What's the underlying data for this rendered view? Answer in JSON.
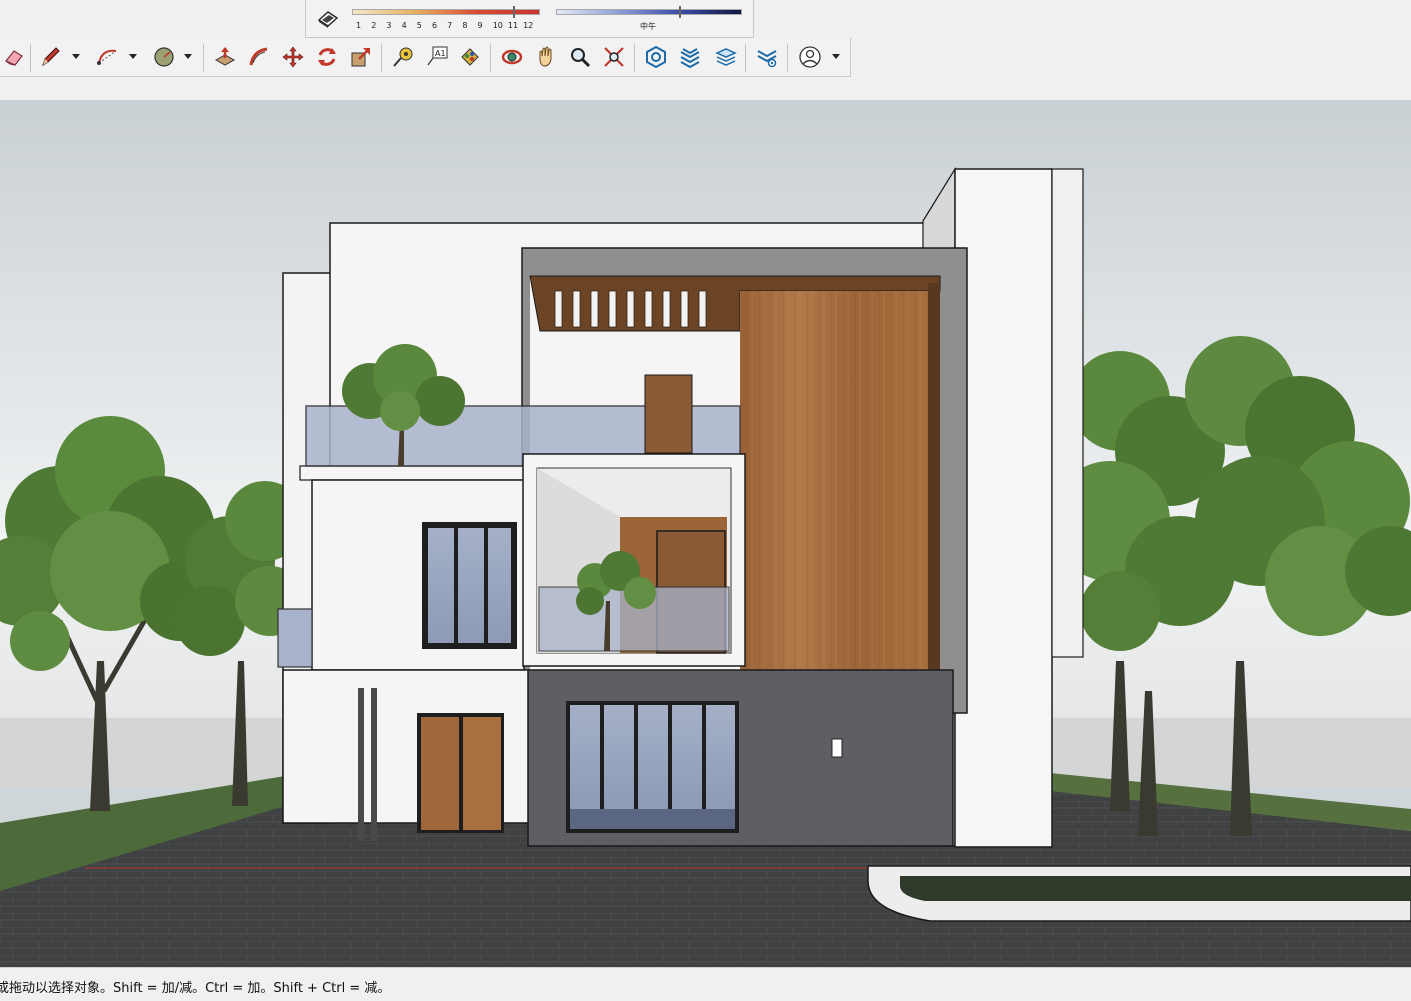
{
  "shadow_settings": {
    "months": [
      "1",
      "2",
      "3",
      "4",
      "5",
      "6",
      "7",
      "8",
      "9",
      "10",
      "11",
      "12"
    ],
    "time_label": "中午"
  },
  "toolbar": {
    "tools": [
      {
        "name": "eraser-icon"
      },
      {
        "name": "pencil-icon"
      },
      {
        "name": "arc-icon"
      },
      {
        "name": "circle-icon"
      },
      {
        "name": "push-pull-icon"
      },
      {
        "name": "follow-me-icon"
      },
      {
        "name": "move-icon"
      },
      {
        "name": "rotate-icon"
      },
      {
        "name": "scale-icon"
      },
      {
        "name": "tape-measure-icon"
      },
      {
        "name": "text-icon"
      },
      {
        "name": "paint-bucket-icon"
      },
      {
        "name": "orbit-icon"
      },
      {
        "name": "pan-icon"
      },
      {
        "name": "zoom-icon"
      },
      {
        "name": "zoom-extents-icon"
      },
      {
        "name": "layout-icon"
      },
      {
        "name": "sandbox-icon"
      },
      {
        "name": "layers-icon"
      },
      {
        "name": "extension-icon"
      },
      {
        "name": "user-account-icon"
      }
    ]
  },
  "status": {
    "text": "或拖动以选择对象。Shift = 加/减。Ctrl = 加。Shift + Ctrl = 减。"
  },
  "colors": {
    "sky": "#cfd6da",
    "ground": "#3f4143",
    "wood": "#a0683a",
    "facade": "#f2f2f2",
    "dark_wall": "#5d5f62"
  }
}
